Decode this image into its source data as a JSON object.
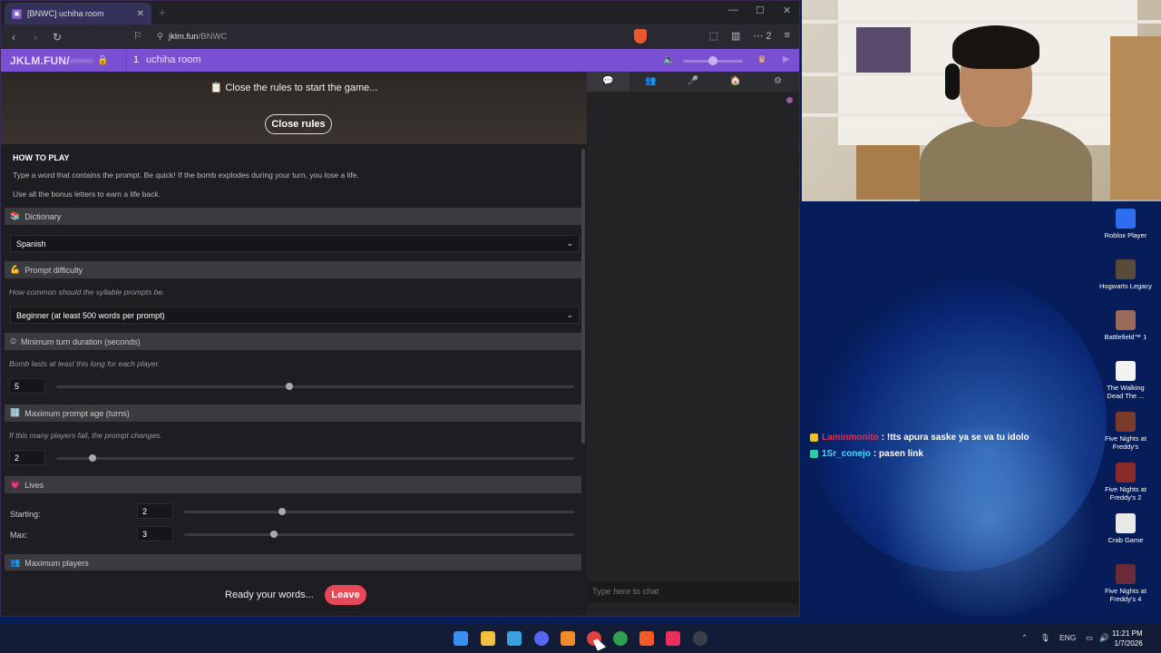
{
  "browser": {
    "tab_title": "[BNWC] uchiha room",
    "tab_close": "✕",
    "new_tab": "+",
    "url_host": "jklm.fun",
    "url_path": "/BNWC",
    "ext_count": "2"
  },
  "site": {
    "logo": "JKLM.FUN/",
    "logo_hidden": "••••••",
    "room_number": "1",
    "room_name": "uchiha room"
  },
  "rules": {
    "message": "Close the rules to start the game...",
    "close_label": "Close rules"
  },
  "howto": {
    "title": "HOW TO PLAY",
    "line1": "Type a word that contains the prompt. Be quick! If the bomb explodes during your turn, you lose a life.",
    "line2": "Use all the bonus letters to earn a life back."
  },
  "settings": {
    "dictionary": {
      "label": "Dictionary",
      "value": "Spanish"
    },
    "difficulty": {
      "label": "Prompt difficulty",
      "hint": "How common should the syllable prompts be.",
      "value": "Beginner (at least 500 words per prompt)"
    },
    "min_turn": {
      "label": "Minimum turn duration (seconds)",
      "hint": "Bomb lasts at least this long for each player.",
      "value": "5",
      "fraction": 0.45
    },
    "max_prompt_age": {
      "label": "Maximum prompt age (turns)",
      "hint": "If this many players fail, the prompt changes.",
      "value": "2",
      "fraction": 0.07
    },
    "lives": {
      "label": "Lives",
      "starting_label": "Starting:",
      "starting_value": "2",
      "starting_fraction": 0.25,
      "max_label": "Max:",
      "max_value": "3",
      "max_fraction": 0.23
    },
    "max_players": {
      "label": "Maximum players"
    }
  },
  "footer": {
    "ready_text": "Ready your words...",
    "leave_label": "Leave"
  },
  "chat": {
    "placeholder": "Type here to chat",
    "overlay": [
      {
        "user": "Laminmonito",
        "msg": ": !tts apura saske ya se va tu idolo",
        "color": "#e0304a",
        "badge": "#f0c020"
      },
      {
        "user": "1Sr_conejo",
        "msg": ": pasen link",
        "color": "#4fd9ff",
        "badge": "#2ad1a0"
      }
    ]
  },
  "desktop_icons": [
    {
      "label": "Roblox Player",
      "color": "#2f6df0"
    },
    {
      "label": "Hogwarts Legacy",
      "color": "#5a4a3a"
    },
    {
      "label": "Battlefield™ 1",
      "color": "#9a6b5a"
    },
    {
      "label": "The Walking Dead The ...",
      "color": "#f2f2f2"
    },
    {
      "label": "Five Nights at Freddy's",
      "color": "#7a3b2a"
    },
    {
      "label": "Five Nights at Freddy's 2",
      "color": "#8a2a2a"
    },
    {
      "label": "Crab Game",
      "color": "#e8e8e8"
    },
    {
      "label": "Five Nights at Freddy's 4",
      "color": "#6a2a3a"
    }
  ],
  "taskbar": {
    "lang": "ENG",
    "time": "11:21 PM",
    "date": "1/7/2026"
  }
}
